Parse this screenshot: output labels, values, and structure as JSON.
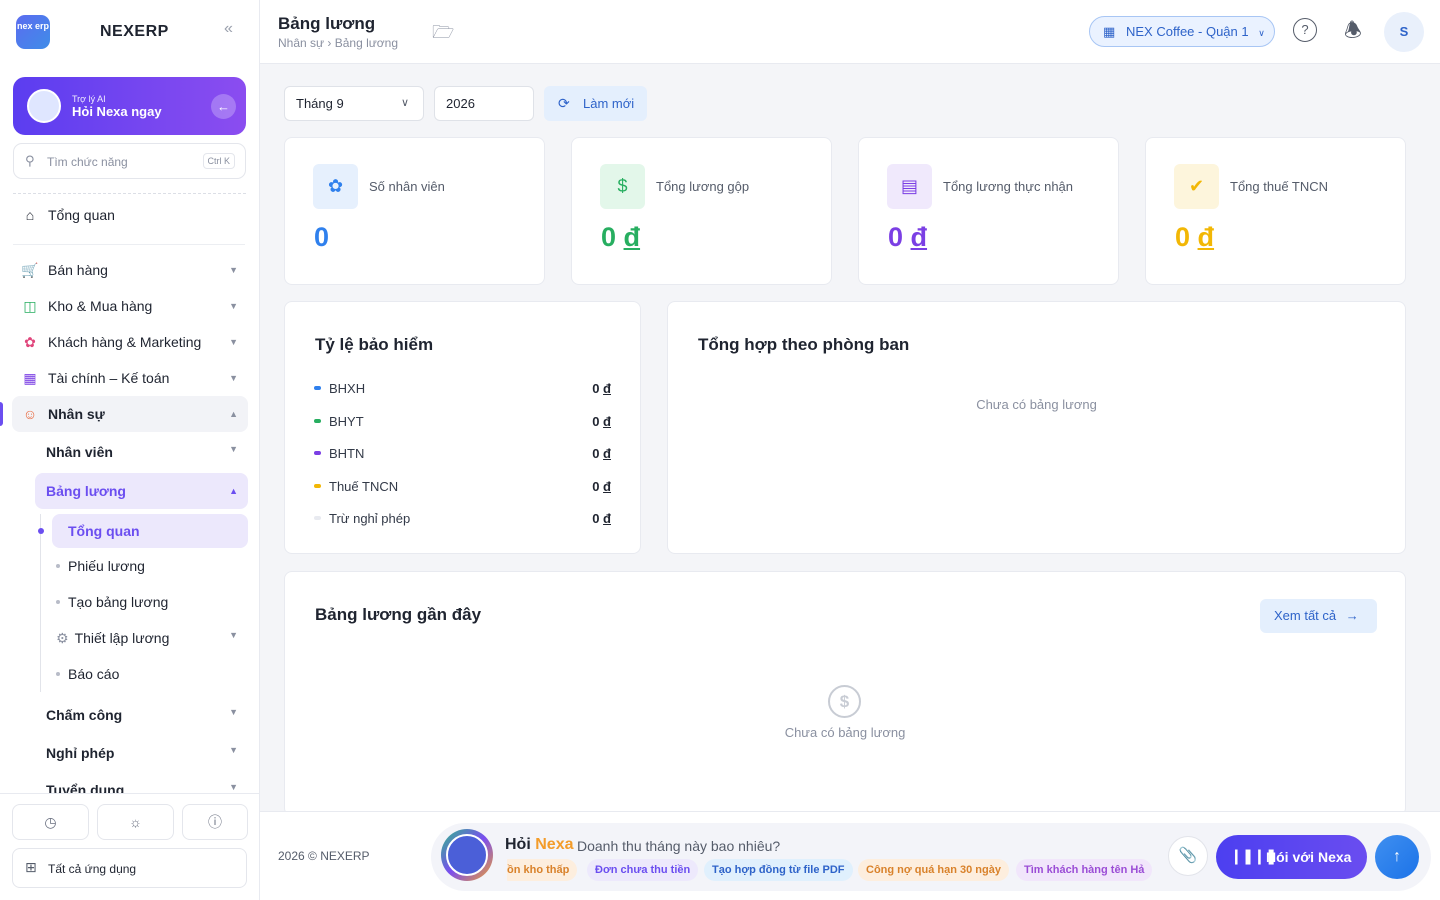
{
  "brand": {
    "logo_text": "nex erp",
    "name": "NEXERP",
    "collapse_icon": "«"
  },
  "ai_card": {
    "subtitle": "Trợ lý AI",
    "title": "Hỏi Nexa ngay",
    "go_icon": "←"
  },
  "search": {
    "placeholder": "Tìm chức năng",
    "shortcut": "Ctrl K"
  },
  "nav": {
    "overview": "Tổng quan",
    "sales": "Bán hàng",
    "warehouse": "Kho & Mua hàng",
    "crm": "Khách hàng & Marketing",
    "finance": "Tài chính – Kế toán",
    "hr": "Nhân sự",
    "hr_children": {
      "employees": "Nhân viên",
      "payroll": "Bảng lương",
      "payroll_children": {
        "overview": "Tổng quan",
        "payslip": "Phiếu lương",
        "create": "Tạo bảng lương",
        "settings": "Thiết lập lương",
        "report": "Báo cáo"
      },
      "attendance": "Chấm công",
      "leave": "Nghỉ phép",
      "recruitment": "Tuyển dụng"
    }
  },
  "sidebar_footer": {
    "all_apps": "Tất cả ứng dụng"
  },
  "header": {
    "title": "Bảng lương",
    "breadcrumb": "Nhân sự › Bảng lương",
    "store": "NEX Coffee - Quận 1",
    "help_icon": "?",
    "avatar": "S"
  },
  "filters": {
    "month": "Tháng 9",
    "year": "2026",
    "refresh": "Làm mới"
  },
  "stats": [
    {
      "label": "Số nhân viên",
      "value": "0",
      "unit": "",
      "color": "#2f80ed",
      "bg": "#e6f0fd",
      "icon": "people-icon"
    },
    {
      "label": "Tổng lương gộp",
      "value": "0",
      "unit": "đ",
      "color": "#27ae60",
      "bg": "#e3f7ea",
      "icon": "dollar-icon"
    },
    {
      "label": "Tổng lương thực nhận",
      "value": "0",
      "unit": "đ",
      "color": "#7b3fe4",
      "bg": "#f0e9fc",
      "icon": "wallet-icon"
    },
    {
      "label": "Tổng thuế TNCN",
      "value": "0",
      "unit": "đ",
      "color": "#f2b705",
      "bg": "#fdf5dc",
      "icon": "shield-check-icon"
    }
  ],
  "insurance": {
    "title": "Tỷ lệ bảo hiểm",
    "rows": [
      {
        "label": "BHXH",
        "value": "0",
        "unit": "đ",
        "color": "#2f80ed"
      },
      {
        "label": "BHYT",
        "value": "0",
        "unit": "đ",
        "color": "#27ae60"
      },
      {
        "label": "BHTN",
        "value": "0",
        "unit": "đ",
        "color": "#7b3fe4"
      },
      {
        "label": "Thuế TNCN",
        "value": "0",
        "unit": "đ",
        "color": "#f2b705"
      },
      {
        "label": "Trừ nghỉ phép",
        "value": "0",
        "unit": "đ",
        "color": "#e8eaf0"
      }
    ]
  },
  "department": {
    "title": "Tổng hợp theo phòng ban",
    "empty": "Chưa có bảng lương"
  },
  "recent": {
    "title": "Bảng lương gần đây",
    "view_all": "Xem tất cả",
    "empty": "Chưa có bảng lương",
    "empty_icon": "$"
  },
  "footer": {
    "copyright": "2026 © NEXERP",
    "nexa_title_1": "Hỏi",
    "nexa_title_2": "Nexa",
    "question": "Doanh thu tháng này bao nhiêu?",
    "chips": [
      {
        "label": "ồn kho thấp",
        "bg": "#fdeede",
        "color": "#d9822b"
      },
      {
        "label": "Đơn chưa thu tiền",
        "bg": "#ede9fc",
        "color": "#6b4ef0"
      },
      {
        "label": "Tạo hợp đồng từ file PDF",
        "bg": "#e0f0fd",
        "color": "#2e63c9"
      },
      {
        "label": "Công nợ quá hạn 30 ngày",
        "bg": "#fdeede",
        "color": "#d9822b"
      },
      {
        "label": "Tìm khách hàng tên Hả",
        "bg": "#f1e6fb",
        "color": "#9b4dd6"
      }
    ],
    "talk": "Nói với Nexa",
    "send_icon": "↑"
  }
}
